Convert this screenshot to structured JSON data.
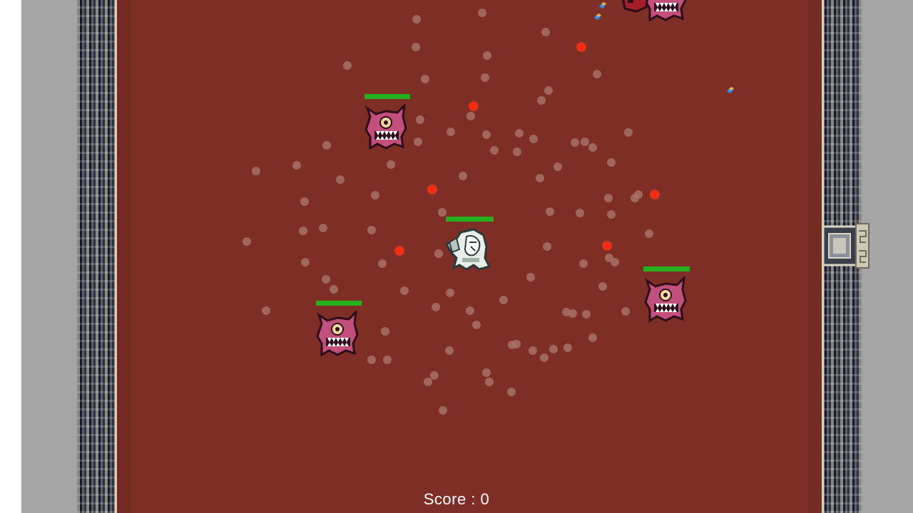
{
  "hud": {
    "score_label": "Score : 0",
    "score_value": 0
  },
  "player": {
    "health": 1.0
  },
  "enemies": [
    {
      "type": "pink-cyclops-monster",
      "health": 1.0
    },
    {
      "type": "pink-cyclops-monster",
      "health": 1.0
    },
    {
      "type": "pink-cyclops-monster",
      "health": 1.0
    },
    {
      "type": "pink-cyclops-monster",
      "health": null
    },
    {
      "type": "red-monster",
      "health": null
    }
  ],
  "colors": {
    "floor": "#7f2e25",
    "health_bar": "#24b01c",
    "enemy_bullet": "#ff2a10",
    "dust_particle": "#a77066"
  },
  "icons": {
    "player": "ghost-knight-icon",
    "enemy": "cyclops-monster-icon",
    "pickup": "gem-icon",
    "door": "dungeon-door-icon"
  }
}
